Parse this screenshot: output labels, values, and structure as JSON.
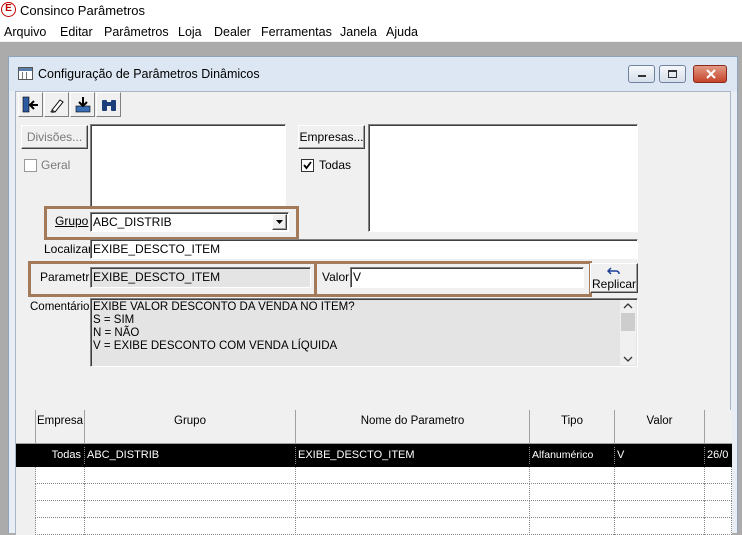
{
  "app": {
    "title": "Consinco Parâmetros",
    "logo_letter": "E"
  },
  "menu": [
    "Arquivo",
    "Editar",
    "Parâmetros",
    "Loja",
    "Dealer",
    "Ferramentas",
    "Janela",
    "Ajuda"
  ],
  "window": {
    "title": "Configuração de Parâmetros Dinâmicos"
  },
  "toolbar": {
    "icons": [
      "exit-icon",
      "eraser-icon",
      "save-icon",
      "search-binoculars-icon"
    ]
  },
  "form": {
    "divisoes_label": "Divisões...",
    "geral_label": "Geral",
    "geral_checked": false,
    "empresas_label": "Empresas...",
    "todas_label": "Todas",
    "todas_checked": true,
    "grupo_label": "Grupo",
    "grupo_value": "ABC_DISTRIB",
    "localizar_label": "Localizar",
    "localizar_value": "EXIBE_DESCTO_ITEM",
    "parametro_label": "Parametro",
    "parametro_value": "EXIBE_DESCTO_ITEM",
    "valor_label": "Valor",
    "valor_value": "V",
    "replicar_label": "Replicar",
    "comentarios_label": "Comentários",
    "comentarios_lines": [
      "EXIBE VALOR DESCONTO DA VENDA NO ITEM?",
      "S = SIM",
      "N = NÃO",
      "V = EXIBE DESCONTO COM VENDA LÍQUIDA"
    ]
  },
  "grid": {
    "headers": [
      "Empresa",
      "Grupo",
      "Nome do Parametro",
      "Tipo",
      "Valor",
      ""
    ],
    "rows": [
      [
        "Todas",
        "ABC_DISTRIB",
        "EXIBE_DESCTO_ITEM",
        "Alfanumérico",
        "V",
        "26/0"
      ]
    ]
  },
  "colors": {
    "highlight_border": "#a37a5a",
    "selected_row": "#000000",
    "title_gradient": "#dde7f3"
  }
}
